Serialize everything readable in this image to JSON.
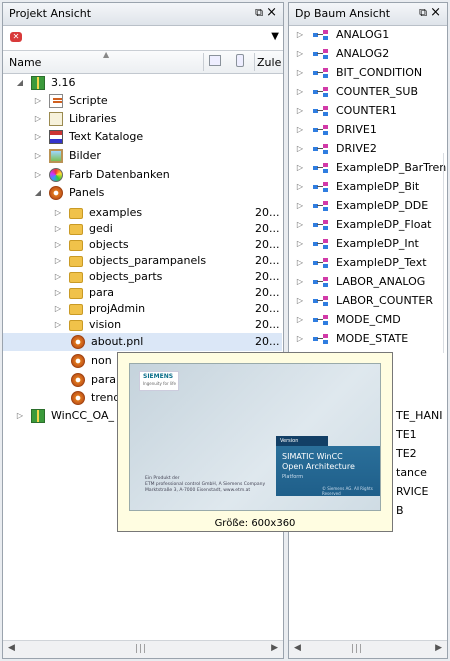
{
  "left_panel": {
    "title": "Projekt Ansicht",
    "pin_icon": "pin-icon",
    "close_label": "×",
    "col_name": "Name",
    "col_date": "Zule",
    "tree": [
      {
        "label": "3.16",
        "icon": "gift-icon",
        "level": 0,
        "expanded": true,
        "date": ""
      },
      {
        "label": "Scripte",
        "icon": "script-icon",
        "level": 1,
        "expanded": false,
        "date": ""
      },
      {
        "label": "Libraries",
        "icon": "library-icon",
        "level": 1,
        "expanded": false,
        "date": ""
      },
      {
        "label": "Text Kataloge",
        "icon": "flag-icon",
        "level": 1,
        "expanded": false,
        "date": ""
      },
      {
        "label": "Bilder",
        "icon": "picture-icon",
        "level": 1,
        "expanded": false,
        "date": ""
      },
      {
        "label": "Farb Datenbanken",
        "icon": "palette-icon",
        "level": 1,
        "expanded": false,
        "date": ""
      },
      {
        "label": "Panels",
        "icon": "gear-icon",
        "level": 1,
        "expanded": true,
        "date": ""
      },
      {
        "label": "examples",
        "icon": "folder-icon",
        "level": 2,
        "expanded": false,
        "date": "20..."
      },
      {
        "label": "gedi",
        "icon": "folder-icon",
        "level": 2,
        "expanded": false,
        "date": "20..."
      },
      {
        "label": "objects",
        "icon": "folder-icon",
        "level": 2,
        "expanded": false,
        "date": "20..."
      },
      {
        "label": "objects_parampanels",
        "icon": "folder-icon",
        "level": 2,
        "expanded": false,
        "date": "20..."
      },
      {
        "label": "objects_parts",
        "icon": "folder-icon",
        "level": 2,
        "expanded": false,
        "date": "20..."
      },
      {
        "label": "para",
        "icon": "folder-icon",
        "level": 2,
        "expanded": false,
        "date": "20..."
      },
      {
        "label": "projAdmin",
        "icon": "folder-icon",
        "level": 2,
        "expanded": false,
        "date": "20..."
      },
      {
        "label": "vision",
        "icon": "folder-icon",
        "level": 2,
        "expanded": false,
        "date": "20..."
      },
      {
        "label": "about.pnl",
        "icon": "gear-icon",
        "level": 2,
        "leaf": true,
        "date": "20...",
        "selected": true
      },
      {
        "label": "non",
        "icon": "gear-icon",
        "level": 2,
        "leaf": true,
        "date": ""
      },
      {
        "label": "para",
        "icon": "gear-icon",
        "level": 2,
        "leaf": true,
        "date": ""
      },
      {
        "label": "trend",
        "icon": "gear-icon",
        "level": 2,
        "leaf": true,
        "date": ""
      },
      {
        "label": "WinCC_OA_",
        "icon": "gift-icon",
        "level": 0,
        "expanded": false,
        "date": ""
      }
    ]
  },
  "right_panel": {
    "title": "Dp Baum Ansicht",
    "close_label": "×",
    "items": [
      "ANALOG1",
      "ANALOG2",
      "BIT_CONDITION",
      "COUNTER_SUB",
      "COUNTER1",
      "DRIVE1",
      "DRIVE2",
      "ExampleDP_BarTren",
      "ExampleDP_Bit",
      "ExampleDP_DDE",
      "ExampleDP_Float",
      "ExampleDP_Int",
      "ExampleDP_Text",
      "LABOR_ANALOG",
      "LABOR_COUNTER",
      "MODE_CMD",
      "MODE_STATE"
    ],
    "hidden_items": [
      "TE_HANI",
      "TE1",
      "TE2",
      "tance",
      "RVICE",
      "B"
    ]
  },
  "tooltip": {
    "caption": "Größe: 600x360",
    "logo_text": "SIEMENS",
    "logo_tag": "Ingenuity for life",
    "version_label": "Version",
    "product_line1": "SIMATIC WinCC",
    "product_line2": "Open Architecture",
    "product_line3": "Platform",
    "copyright": "© Siemens AG. All Rights Reserved",
    "credit_line1": "Ein Produkt der",
    "credit_line2": "ETM professional control GmbH, A Siemens Company",
    "credit_line3": "Marktstraße 3, A-7000 Eisenstadt, www.etm.at"
  }
}
